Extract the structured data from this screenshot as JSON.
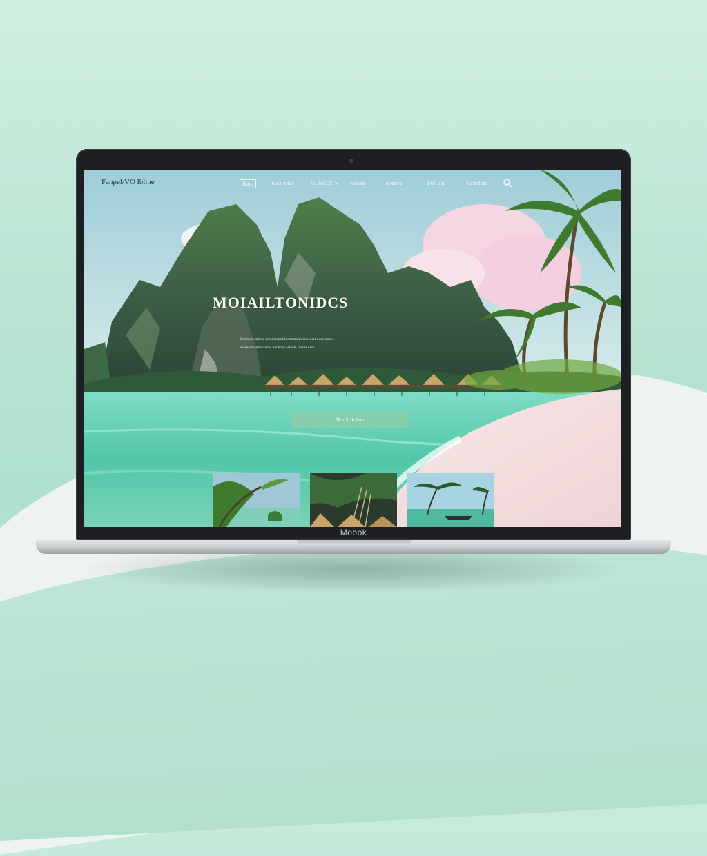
{
  "device": {
    "brand_label": "Mobok"
  },
  "site": {
    "logo_text": "Fanpel/VO lbline",
    "nav": {
      "items": [
        {
          "label": "Bato",
          "boxed": true
        },
        {
          "label": "atas nnla",
          "boxed": false
        },
        {
          "label": "GEMDATV",
          "boxed": false
        },
        {
          "label": "enasa",
          "boxed": false
        },
        {
          "label": "ananes",
          "boxed": false
        },
        {
          "label": "Fulllen",
          "boxed": false
        },
        {
          "label": "Lemdait",
          "boxed": false
        }
      ],
      "search_icon": "search-icon"
    },
    "hero": {
      "title": "MOIAILTONIDCS",
      "subtitle_line1": "Semnnen mmun orsanmenad tonnmmntn onnedaras eneomnn",
      "subtitle_line2": "aseseamn Bosnaneaa anneosn seteom tnesas onta",
      "cta_label": "Bordt lichou"
    },
    "gallery": {
      "items": [
        {
          "name": "palm-beach"
        },
        {
          "name": "palm-fronds-huts"
        },
        {
          "name": "palms-boat"
        }
      ]
    }
  },
  "colors": {
    "accent": "#8ccdaa",
    "backdrop": "#b9e3d2",
    "water": "#5cc9ae",
    "sand": "#f4dfdf"
  }
}
